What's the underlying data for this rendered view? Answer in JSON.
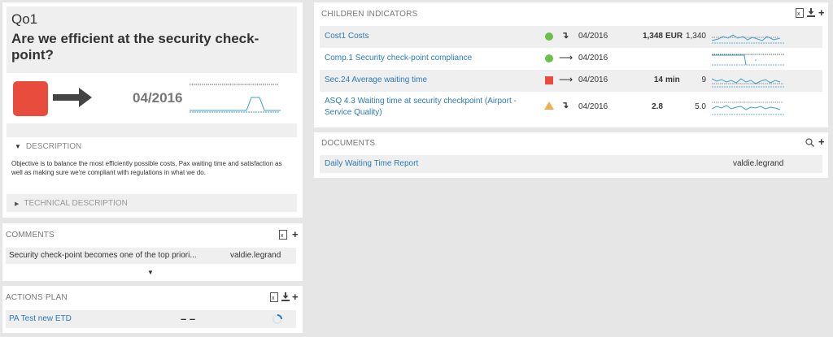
{
  "objective": {
    "code": "Qo1",
    "title": "Are we efficient at the security check-point?",
    "status_color": "#e74c3c",
    "trend_icon": "right-arrow-icon",
    "date": "04/2016",
    "description_label": "DESCRIPTION",
    "description_text": "Objective is to balance the most efficiently possible costs, Pax waiting time and satisfaction as well as making sure we're compliant with regulations in what we do.",
    "technical_label": "TECHNICAL DESCRIPTION"
  },
  "comments": {
    "header": "COMMENTS",
    "items": [
      {
        "text": "Security check-point becomes one of the top priori...",
        "author": "valdie.legrand"
      }
    ]
  },
  "actions": {
    "header": "ACTIONS PLAN",
    "items": [
      {
        "name": "PA Test new ETD",
        "value": "– –"
      }
    ]
  },
  "children": {
    "header": "CHILDREN INDICATORS",
    "rows": [
      {
        "name": "Cost1 Costs",
        "status": "green",
        "status_color": "#6cc04a",
        "trend": "down-arrow-icon",
        "date": "04/2016",
        "value": "1,348",
        "unit": "EUR",
        "target": "1,340"
      },
      {
        "name": "Comp.1 Security check-point compliance",
        "status": "green",
        "status_color": "#6cc04a",
        "trend": "right-arrow-icon",
        "date": "04/2016",
        "value": "",
        "unit": "",
        "target": ""
      },
      {
        "name": "Sec.24 Average waiting time",
        "status": "red",
        "status_color": "#e74c3c",
        "trend": "right-arrow-icon",
        "date": "04/2016",
        "value": "14",
        "unit": "min",
        "target": "9"
      },
      {
        "name_line1": "ASQ 4.3 Waiting time at security checkpoint (Airport -",
        "name_line2": "Service Quality)",
        "status": "warning",
        "status_color": "#f0ad4e",
        "trend": "down-arrow-icon",
        "date": "04/2016",
        "value": "2.8",
        "unit": "",
        "target": "5.0"
      }
    ]
  },
  "documents": {
    "header": "DOCUMENTS",
    "items": [
      {
        "name": "Daily Waiting Time Report",
        "author": "valdie.legrand"
      }
    ]
  },
  "colors": {
    "link": "#2a7ab8",
    "background": "#e6e6e6",
    "row_alt": "#efefef",
    "spark": "#3fa0c8"
  }
}
